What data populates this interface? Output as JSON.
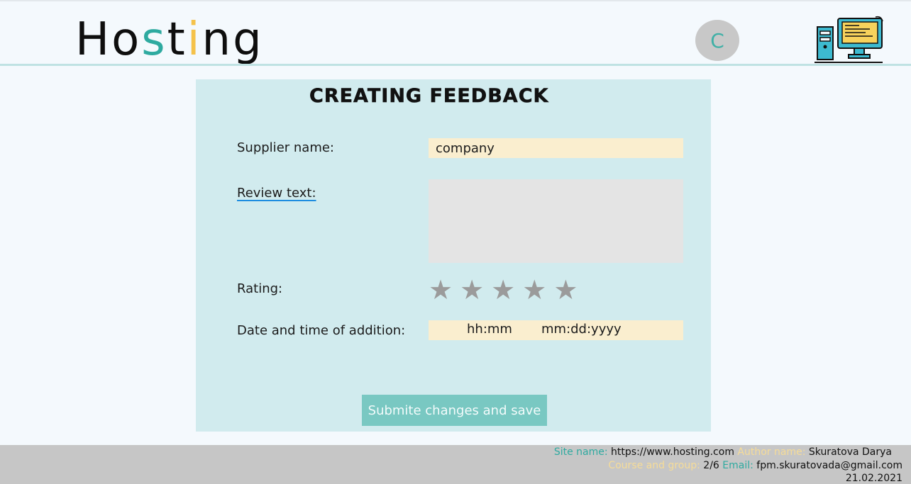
{
  "header": {
    "logo": {
      "part1": "Ho",
      "part2": "s",
      "part3": "t",
      "part4": "i",
      "part5": "ng"
    },
    "avatar_letter": "C",
    "computer_icon": "computer-illustration-icon"
  },
  "form": {
    "title": "Creating feedback",
    "supplier_label": "Supplier name:",
    "supplier_value": "company",
    "review_label": "Review text:",
    "review_value": "",
    "rating_label": "Rating:",
    "rating_value": 0,
    "rating_max": 5,
    "date_label": "Date and time of addition:",
    "time_placeholder": "hh:mm",
    "date_placeholder": "mm:dd:yyyy",
    "submit_label": "Submite changes and save"
  },
  "footer": {
    "site_key": "Site name:",
    "site_value": "https://www.hosting.com",
    "author_key": "Author name:",
    "author_value": "Skuratova Darya",
    "course_key": "Course and group:",
    "course_value": "2/6",
    "email_key": "Email:",
    "email_value": "fpm.skuratovada@gmail.com",
    "date": "21.02.2021"
  },
  "colors": {
    "accent_teal": "#2eaaa0",
    "accent_yellow": "#f5c24a",
    "card_bg": "#d1ebee",
    "input_bg": "#faeecf",
    "button_bg": "#79c8c2",
    "footer_bg": "#c6c6c6"
  }
}
